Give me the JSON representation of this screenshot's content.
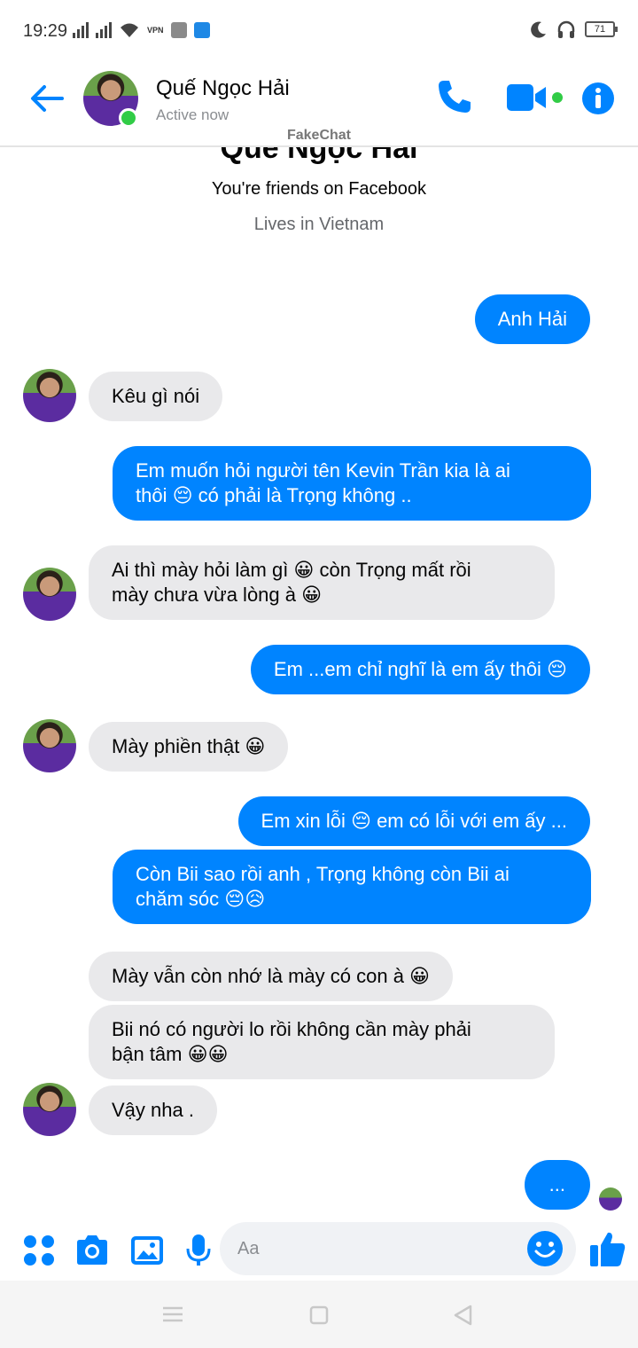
{
  "status_bar": {
    "time": "19:29",
    "vpn_label": "VPN",
    "battery": "71"
  },
  "header": {
    "contact_name": "Quế Ngọc Hải",
    "contact_status": "Active now",
    "watermark": "FakeChat"
  },
  "intro": {
    "name": "Quế Ngọc Hải",
    "friends_text": "You're friends on Facebook",
    "lives_text": "Lives in Vietnam"
  },
  "messages": [
    {
      "side": "out",
      "text": "Anh Hải"
    },
    {
      "side": "in",
      "text": "Kêu gì nói"
    },
    {
      "side": "out",
      "line1": "Em muốn hỏi người tên Kevin Trần kia là ai",
      "line2": "thôi 😔 có phải là Trọng không .."
    },
    {
      "side": "in",
      "line1": "Ai thì mày hỏi làm gì 😀 còn Trọng mất rồi",
      "line2": "mày chưa vừa lòng à 😀"
    },
    {
      "side": "out",
      "text": "Em ...em chỉ nghĩ là em ấy thôi 😔"
    },
    {
      "side": "in",
      "text": "Mày phiền thật 😀"
    },
    {
      "side": "out",
      "text": "Em xin lỗi 😔 em có lỗi với em ấy ..."
    },
    {
      "side": "out",
      "line1": "Còn Bii sao rồi anh , Trọng không còn Bii ai",
      "line2": "chăm sóc 😔😥"
    },
    {
      "side": "in",
      "text": "Mày vẫn còn nhớ là mày có con à 😀"
    },
    {
      "side": "in",
      "line1": "Bii nó có người lo rồi không cần mày phải",
      "line2": "bận tâm 😀😀"
    },
    {
      "side": "in",
      "text": "Vậy nha ."
    },
    {
      "side": "out",
      "text": "..."
    }
  ],
  "composer": {
    "placeholder": "Aa"
  },
  "colors": {
    "accent": "#0084ff",
    "incoming_bubble": "#e9e9eb",
    "online": "#31cc46"
  }
}
